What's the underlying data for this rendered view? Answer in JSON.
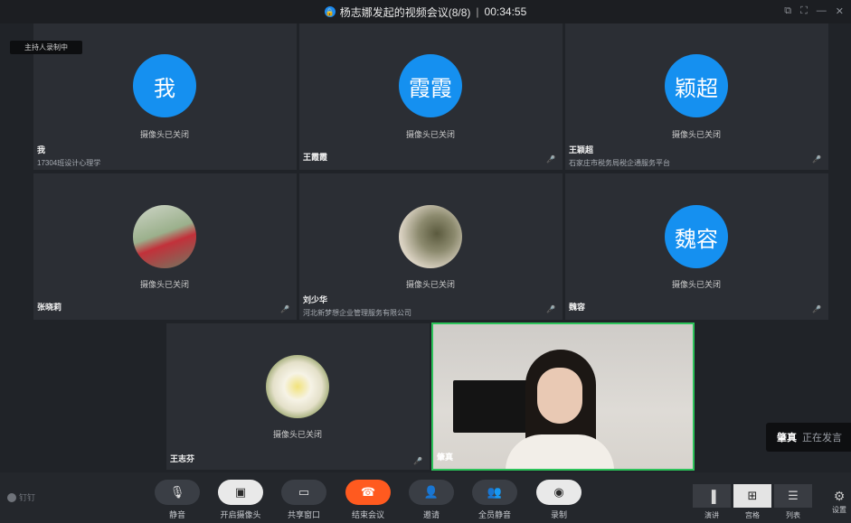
{
  "window": {
    "title": "杨志娜发起的视频会议(8/8)",
    "timer": "00:34:55",
    "controls": [
      "⧉",
      "⛶",
      "—",
      "✕"
    ]
  },
  "recording_badge": "主持人录制中",
  "participants": [
    {
      "name": "我",
      "avatar_text": "我",
      "camera_status": "摄像头已关闭",
      "org": "17304班设计心理学",
      "muted": false
    },
    {
      "name": "王霞霞",
      "avatar_text": "霞霞",
      "camera_status": "摄像头已关闭",
      "org": "",
      "muted": true
    },
    {
      "name": "王颖超",
      "avatar_text": "颖超",
      "camera_status": "摄像头已关闭",
      "org": "石家庄市税务局税企通服务平台",
      "muted": true
    },
    {
      "name": "张晓莉",
      "avatar_text": "",
      "camera_status": "摄像头已关闭",
      "org": "",
      "muted": true
    },
    {
      "name": "刘少华",
      "avatar_text": "",
      "camera_status": "摄像头已关闭",
      "org": "河北新梦想企业管理服务有限公司",
      "muted": true
    },
    {
      "name": "魏容",
      "avatar_text": "魏容",
      "camera_status": "摄像头已关闭",
      "org": "",
      "muted": true
    },
    {
      "name": "王志芬",
      "avatar_text": "",
      "camera_status": "摄像头已关闭",
      "org": "",
      "muted": true
    }
  ],
  "live_video": {
    "name": "肇真"
  },
  "speaking": {
    "name": "肇真",
    "status": "正在发言"
  },
  "toolbar": {
    "brand": "钉钉",
    "buttons": [
      {
        "label": "静音",
        "icon": "mic-icon"
      },
      {
        "label": "开启摄像头",
        "icon": "camera-off-icon"
      },
      {
        "label": "共享窗口",
        "icon": "share-screen-icon"
      },
      {
        "label": "结束会议",
        "icon": "end-call-icon"
      },
      {
        "label": "邀请",
        "icon": "invite-icon"
      },
      {
        "label": "全员静音",
        "icon": "mute-all-icon"
      },
      {
        "label": "录制",
        "icon": "record-icon"
      }
    ],
    "views": [
      {
        "label": "演讲",
        "icon": "speaker-view-icon"
      },
      {
        "label": "宫格",
        "icon": "grid-view-icon",
        "active": true
      },
      {
        "label": "列表",
        "icon": "list-view-icon"
      }
    ],
    "settings_label": "设置"
  },
  "colors": {
    "avatar_blue": "#1590f0",
    "end_call": "#ff5a1f",
    "active_speaker_border": "#2cc35a"
  }
}
